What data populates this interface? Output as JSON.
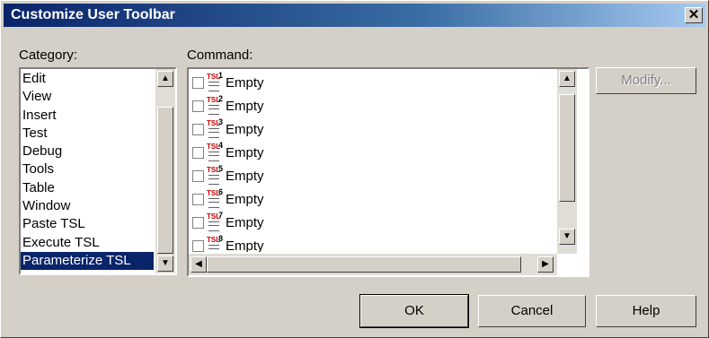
{
  "window": {
    "title": "Customize User Toolbar",
    "close_glyph": "✕"
  },
  "category": {
    "label": "Category:",
    "items": [
      "Edit",
      "View",
      "Insert",
      "Test",
      "Debug",
      "Tools",
      "Table",
      "Window",
      "Paste TSL",
      "Execute TSL",
      "Parameterize TSL"
    ],
    "selected": "Parameterize TSL"
  },
  "command": {
    "label": "Command:",
    "items": [
      {
        "icon": "TSL",
        "num": "1",
        "text": "Empty"
      },
      {
        "icon": "TSL",
        "num": "2",
        "text": "Empty"
      },
      {
        "icon": "TSL",
        "num": "3",
        "text": "Empty"
      },
      {
        "icon": "TSL",
        "num": "4",
        "text": "Empty"
      },
      {
        "icon": "TSL",
        "num": "5",
        "text": "Empty"
      },
      {
        "icon": "TSL",
        "num": "6",
        "text": "Empty"
      },
      {
        "icon": "TSL",
        "num": "7",
        "text": "Empty"
      },
      {
        "icon": "TSL",
        "num": "8",
        "text": "Empty"
      }
    ]
  },
  "buttons": {
    "modify": "Modify...",
    "ok": "OK",
    "cancel": "Cancel",
    "help": "Help"
  },
  "icons": {
    "scroll_up": "▲",
    "scroll_down": "▼",
    "scroll_left": "◀",
    "scroll_right": "▶"
  }
}
